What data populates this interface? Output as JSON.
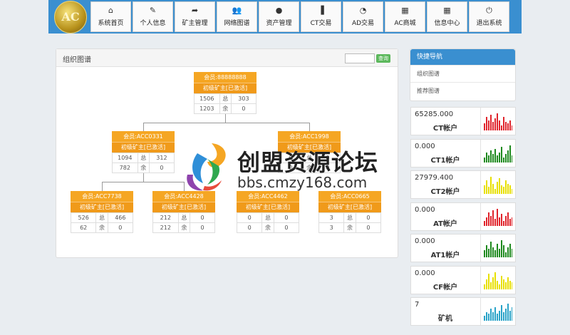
{
  "logo_text": "AC",
  "nav": [
    {
      "icon": "home-icon",
      "glyph": "⌂",
      "label": "系统首页"
    },
    {
      "icon": "edit-icon",
      "glyph": "✎",
      "label": "个人信息"
    },
    {
      "icon": "share-icon",
      "glyph": "➦",
      "label": "矿主管理"
    },
    {
      "icon": "group-icon",
      "glyph": "👥",
      "label": "网络图谱"
    },
    {
      "icon": "user-icon",
      "glyph": "●",
      "label": "资产管理"
    },
    {
      "icon": "bar-chart-icon",
      "glyph": "▐",
      "label": "CT交易"
    },
    {
      "icon": "dashboard-icon",
      "glyph": "◔",
      "label": "AD交易"
    },
    {
      "icon": "calendar-icon",
      "glyph": "▦",
      "label": "AC商城"
    },
    {
      "icon": "calendar-icon",
      "glyph": "▦",
      "label": "信息中心"
    },
    {
      "icon": "power-icon",
      "glyph": "⏻",
      "label": "退出系统"
    }
  ],
  "panel": {
    "title": "组织图谱",
    "search_placeholder": "",
    "search_button": "查询"
  },
  "tree": [
    {
      "id": "root",
      "member": "会员:88888888",
      "level": "初级矿主",
      "status": "[已激活]",
      "left": "1506",
      "total": "总",
      "right": "303",
      "left2": "1203",
      "rest": "余",
      "right2": "0"
    },
    {
      "id": "n1",
      "member": "会员:ACC0331",
      "level": "初级矿主",
      "status": "[已激活]",
      "left": "1094",
      "total": "总",
      "right": "312",
      "left2": "782",
      "rest": "余",
      "right2": "0"
    },
    {
      "id": "n2",
      "member": "会员:ACC1998",
      "level": "初级矿主",
      "status": "[已激活]",
      "left": "0",
      "total": "总",
      "right": "0",
      "left2": "0",
      "rest": "余",
      "right2": "0"
    },
    {
      "id": "n3",
      "member": "会员:ACC7738",
      "level": "初级矿主",
      "status": "[已激活]",
      "left": "526",
      "total": "总",
      "right": "466",
      "left2": "62",
      "rest": "余",
      "right2": "0"
    },
    {
      "id": "n4",
      "member": "会员:ACC4428",
      "level": "初级矿主",
      "status": "[已激活]",
      "left": "212",
      "total": "总",
      "right": "0",
      "left2": "212",
      "rest": "余",
      "right2": "0"
    },
    {
      "id": "n5",
      "member": "会员:ACC4462",
      "level": "初级矿主",
      "status": "[已激活]",
      "left": "0",
      "total": "总",
      "right": "0",
      "left2": "0",
      "rest": "余",
      "right2": "0"
    },
    {
      "id": "n6",
      "member": "会员:ACC0665",
      "level": "初级矿主",
      "status": "[已激活]",
      "left": "3",
      "total": "总",
      "right": "0",
      "left2": "3",
      "rest": "余",
      "right2": "0"
    }
  ],
  "quick": {
    "title": "快捷导航",
    "items": [
      "组织图谱",
      "推荐图谱"
    ]
  },
  "accounts": [
    {
      "value": "65285.000",
      "name": "CT帐户",
      "color": "#e0242c",
      "bars": [
        0.4,
        0.8,
        0.6,
        0.9,
        0.5,
        0.7,
        1.0,
        0.6,
        0.3,
        0.8,
        0.5,
        0.4,
        0.6,
        0.3
      ]
    },
    {
      "value": "0.000",
      "name": "CT1帐户",
      "color": "#1e8a1e",
      "bars": [
        0.3,
        0.6,
        0.4,
        0.7,
        0.5,
        0.8,
        0.4,
        0.6,
        0.9,
        0.3,
        0.5,
        0.7,
        1.0,
        0.4
      ]
    },
    {
      "value": "27979.400",
      "name": "CT2帐户",
      "color": "#e8e000",
      "bars": [
        0.5,
        0.8,
        0.4,
        1.0,
        0.6,
        0.3,
        0.7,
        0.9,
        0.5,
        0.4,
        0.8,
        0.6,
        0.5,
        0.3
      ]
    },
    {
      "value": "0.000",
      "name": "AT帐户",
      "color": "#e0242c",
      "bars": [
        0.3,
        0.5,
        0.8,
        0.6,
        0.9,
        0.4,
        1.0,
        0.5,
        0.7,
        0.3,
        0.6,
        0.8,
        0.4,
        0.5
      ]
    },
    {
      "value": "0.000",
      "name": "AT1帐户",
      "color": "#1e8a1e",
      "bars": [
        0.4,
        0.7,
        0.5,
        0.9,
        0.6,
        0.4,
        0.8,
        0.5,
        1.0,
        0.7,
        0.3,
        0.6,
        0.8,
        0.5
      ]
    },
    {
      "value": "0.000",
      "name": "CF帐户",
      "color": "#e8e000",
      "bars": [
        0.3,
        0.6,
        0.9,
        0.4,
        0.7,
        1.0,
        0.5,
        0.3,
        0.8,
        0.6,
        0.4,
        0.7,
        0.5,
        0.4
      ]
    },
    {
      "value": "7",
      "name": "矿机",
      "color": "#29a3c8",
      "bars": [
        0.3,
        0.5,
        0.4,
        0.7,
        0.5,
        0.8,
        0.4,
        0.6,
        0.9,
        0.5,
        0.7,
        1.0,
        0.6,
        0.8
      ]
    }
  ],
  "watermark": {
    "text": "创盟资源论坛",
    "url": "bbs.cmzy168.com"
  }
}
